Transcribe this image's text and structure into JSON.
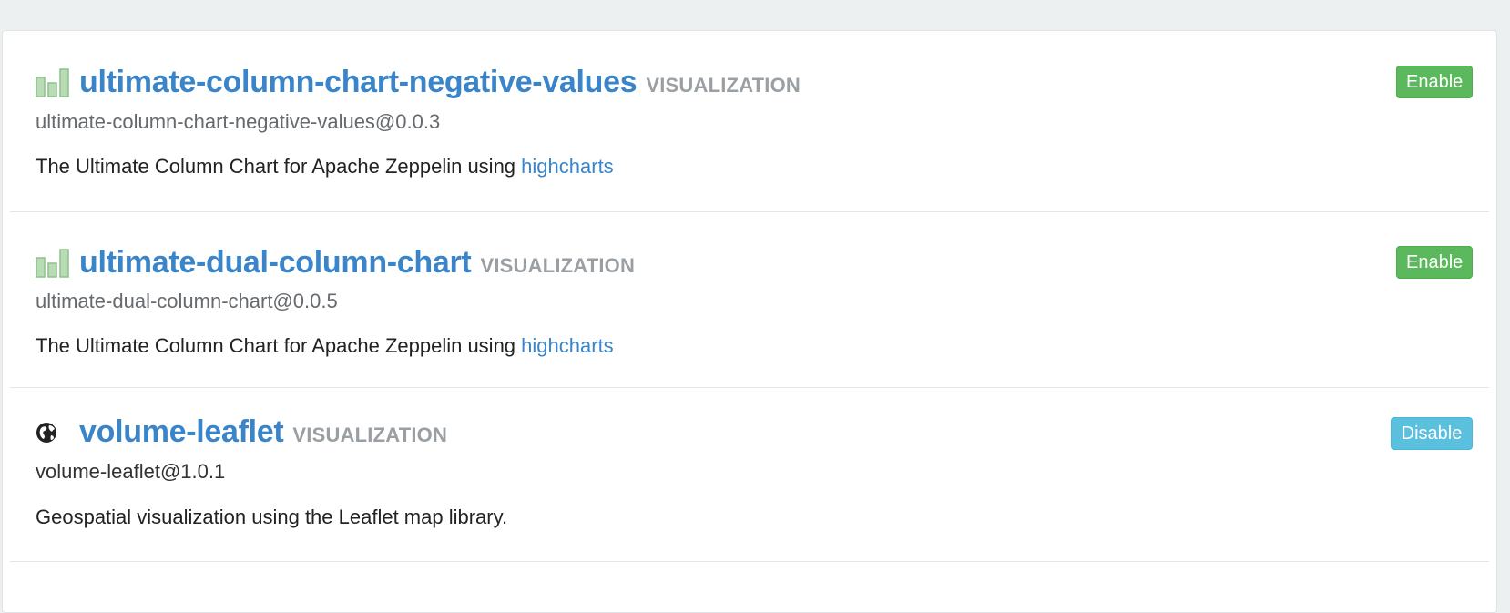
{
  "packages": [
    {
      "icon": "bar-chart-icon",
      "name": "ultimate-column-chart-negative-values",
      "type": "VISUALIZATION",
      "artifact": "ultimate-column-chart-negative-values@0.0.3",
      "description": "The Ultimate Column Chart for Apache Zeppelin using",
      "link_text": "highcharts",
      "button": "Enable"
    },
    {
      "icon": "bar-chart-icon",
      "name": "ultimate-dual-column-chart",
      "type": "VISUALIZATION",
      "artifact": "ultimate-dual-column-chart@0.0.5",
      "description": "The Ultimate Column Chart for Apache Zeppelin using",
      "link_text": "highcharts",
      "button": "Enable"
    },
    {
      "icon": "globe-icon",
      "name": "volume-leaflet",
      "type": "VISUALIZATION",
      "artifact": "volume-leaflet@1.0.1",
      "description": "Geospatial visualization using the Leaflet map library.",
      "button": "Disable"
    }
  ],
  "colors": {
    "link": "#3a85c9",
    "enable": "#5cb85c",
    "disable": "#5bc0de",
    "type_label": "#9a9fa3"
  }
}
